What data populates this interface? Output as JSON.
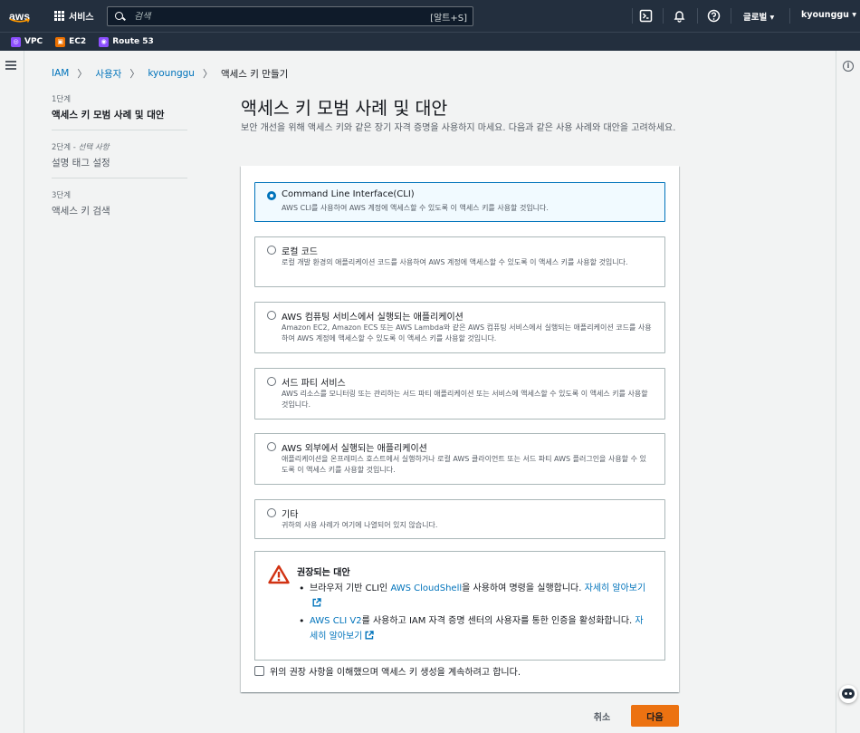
{
  "topnav": {
    "logo": "aws",
    "services_label": "서비스",
    "search_placeholder": "검색",
    "search_shortcut": "[알트+S]",
    "region_label": "글로벌 ▾",
    "account_label": "kyounggu ▾",
    "icons": [
      "cloudshell-icon",
      "bell-icon",
      "help-icon"
    ]
  },
  "favorites": [
    {
      "label": "VPC",
      "color": "#8c4fff"
    },
    {
      "label": "EC2",
      "color": "#ed7100"
    },
    {
      "label": "Route 53",
      "color": "#8c4fff"
    }
  ],
  "breadcrumb": {
    "items": [
      "IAM",
      "사용자",
      "kyounggu"
    ],
    "current": "액세스 키 만들기",
    "separator": "〉"
  },
  "steps": [
    {
      "num": "1단계",
      "optional": "",
      "label": "액세스 키 모범 사례 및 대안",
      "active": true
    },
    {
      "num": "2단계 - ",
      "optional": "선택 사항",
      "label": "설명 태그 설정",
      "active": false
    },
    {
      "num": "3단계",
      "optional": "",
      "label": "액세스 키 검색",
      "active": false
    }
  ],
  "page": {
    "title": "액세스 키 모범 사례 및 대안",
    "description": "보안 개선을 위해 액세스 키와 같은 장기 자격 증명을 사용하지 마세요. 다음과 같은 사용 사례와 대안을 고려하세요."
  },
  "options": [
    {
      "title": "Command Line Interface(CLI)",
      "desc": "AWS CLI를 사용하여 AWS 계정에 액세스할 수 있도록 이 액세스 키를 사용할 것입니다.",
      "selected": true
    },
    {
      "title": "로컬 코드",
      "desc": "로컬 개발 환경의 애플리케이션 코드를 사용하여 AWS 계정에 액세스할 수 있도록 이 액세스 키를 사용할 것입니다.",
      "selected": false
    },
    {
      "title": "AWS 컴퓨팅 서비스에서 실행되는 애플리케이션",
      "desc": "Amazon EC2, Amazon ECS 또는 AWS Lambda와 같은 AWS 컴퓨팅 서비스에서 실행되는 애플리케이션 코드를 사용하여 AWS 계정에 액세스할 수 있도록 이 액세스 키를 사용할 것입니다.",
      "selected": false
    },
    {
      "title": "서드 파티 서비스",
      "desc": "AWS 리소스를 모니터링 또는 관리하는 서드 파티 애플리케이션 또는 서비스에 액세스할 수 있도록 이 액세스 키를 사용할 것입니다.",
      "selected": false
    },
    {
      "title": "AWS 외부에서 실행되는 애플리케이션",
      "desc": "애플리케이션을 온프레미스 호스트에서 실행하거나 로컬 AWS 클라이언트 또는 서드 파티 AWS 플러그인을 사용할 수 있도록 이 액세스 키를 사용할 것입니다.",
      "selected": false
    },
    {
      "title": "기타",
      "desc": "귀하의 사용 사례가 여기에 나열되어 있지 않습니다.",
      "selected": false
    }
  ],
  "warning": {
    "title": "권장되는 대안",
    "item1_prefix": "브라우저 기반 CLI인 ",
    "item1_link": "AWS CloudShell",
    "item1_suffix": "을 사용하여 명령을 실행합니다. ",
    "item1_more": "자세히 알아보기",
    "item2_link": "AWS CLI V2",
    "item2_suffix": "를 사용하고 IAM 자격 증명 센터의 사용자를 통한 인증을 활성화합니다. ",
    "item2_more": "자세히 알아보기"
  },
  "ack_label": "위의 권장 사항을 이해했으며 액세스 키 생성을 계속하려고 합니다.",
  "buttons": {
    "cancel": "취소",
    "next": "다음"
  },
  "colors": {
    "accent": "#0073bb",
    "primary_button": "#ec7211",
    "nav_bg": "#232f3e",
    "warning": "#d13212"
  }
}
